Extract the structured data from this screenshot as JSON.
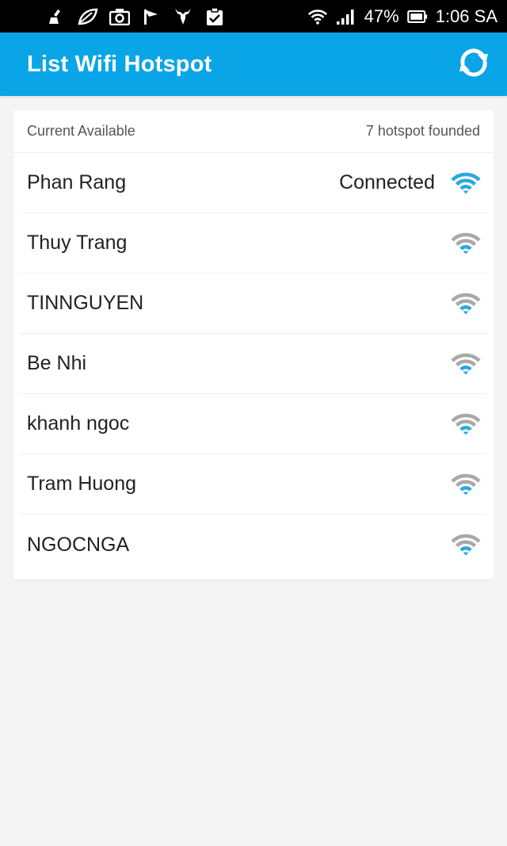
{
  "status_bar": {
    "notification_icons": [
      "broom-icon",
      "leaf-icon",
      "camera-icon",
      "flag-icon",
      "deer-icon",
      "clipboard-check-icon"
    ],
    "battery_percent": "47%",
    "clock": "1:06 SA"
  },
  "app_bar": {
    "title": "List Wifi Hotspot",
    "refresh_icon": "refresh-icon"
  },
  "list_header": {
    "left": "Current Available",
    "right": "7 hotspot founded"
  },
  "colors": {
    "app_bar": "#0aa5e6",
    "wifi_active": "#29a9e0",
    "wifi_inactive": "#a9a9a9"
  },
  "hotspots": [
    {
      "name": "Phan Rang",
      "status": "Connected",
      "connected": true
    },
    {
      "name": "Thuy Trang",
      "status": "",
      "connected": false
    },
    {
      "name": "TINNGUYEN",
      "status": "",
      "connected": false
    },
    {
      "name": "Be Nhi",
      "status": "",
      "connected": false
    },
    {
      "name": "khanh ngoc",
      "status": "",
      "connected": false
    },
    {
      "name": "Tram Huong",
      "status": "",
      "connected": false
    },
    {
      "name": "NGOCNGA",
      "status": "",
      "connected": false
    }
  ]
}
